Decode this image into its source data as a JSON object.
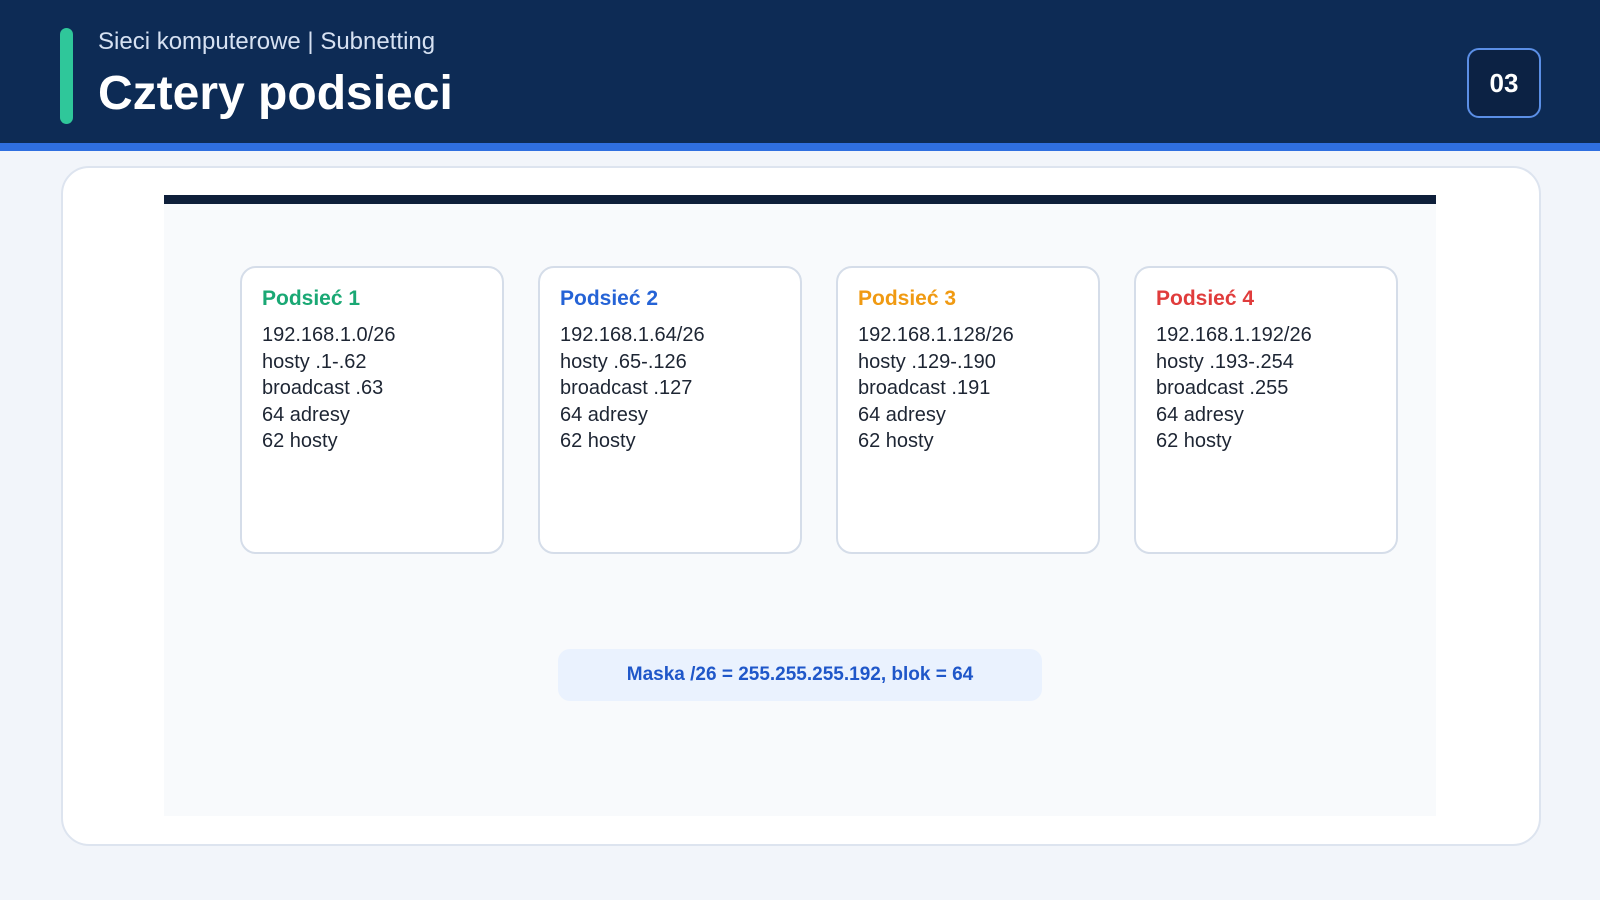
{
  "header": {
    "subtitle": "Sieci komputerowe | Subnetting",
    "title": "Cztery podsieci",
    "page_number": "03"
  },
  "colors": {
    "header_bg": "#0d2b55",
    "accent": "#2fc79a",
    "stripe": "#2f6fe0",
    "subnet1": "#1aa874",
    "subnet2": "#2563d6",
    "subnet3": "#f09a12",
    "subnet4": "#e03c3c"
  },
  "subnets": [
    {
      "title": "Podsieć 1",
      "color": "#1aa874",
      "lines": [
        "192.168.1.0/26",
        "hosty .1-.62",
        "broadcast .63",
        "64 adresy",
        "62 hosty"
      ]
    },
    {
      "title": "Podsieć 2",
      "color": "#2563d6",
      "lines": [
        "192.168.1.64/26",
        "hosty .65-.126",
        "broadcast .127",
        "64 adresy",
        "62 hosty"
      ]
    },
    {
      "title": "Podsieć 3",
      "color": "#f09a12",
      "lines": [
        "192.168.1.128/26",
        "hosty .129-.190",
        "broadcast .191",
        "64 adresy",
        "62 hosty"
      ]
    },
    {
      "title": "Podsieć 4",
      "color": "#e03c3c",
      "lines": [
        "192.168.1.192/26",
        "hosty .193-.254",
        "broadcast .255",
        "64 adresy",
        "62 hosty"
      ]
    }
  ],
  "note": "Maska /26 = 255.255.255.192, blok = 64"
}
